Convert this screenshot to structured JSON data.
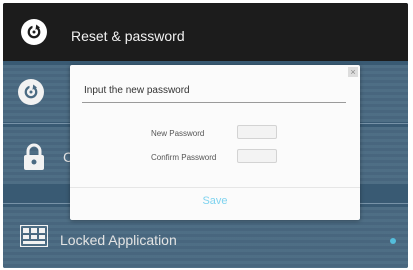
{
  "header": {
    "title": "Reset & password",
    "icon": "reset-icon"
  },
  "rows": [
    {
      "icon": "reset-icon"
    },
    {
      "title_fragment": "C",
      "icon": "lock-icon"
    },
    {
      "title": "Locked Application",
      "icon": "apps-grid-icon"
    }
  ],
  "dialog": {
    "title": "Input the new password",
    "new_password_label": "New Password",
    "confirm_password_label": "Confirm Password",
    "save_label": "Save"
  },
  "colors": {
    "header_bg": "#1c1c1c",
    "row_bg": "#4e7089",
    "accent": "#7fd3ef",
    "status_dot": "#59c9e8"
  }
}
